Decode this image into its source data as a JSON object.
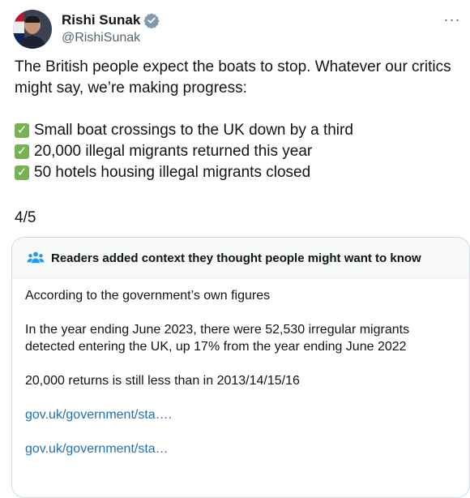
{
  "author": {
    "name": "Rishi Sunak",
    "handle": "@RishiSunak"
  },
  "tweet": {
    "intro": "The British people expect the boats to stop. Whatever our critics might say, we’re making progress:",
    "checklist": [
      "Small boat crossings to the UK down by a third",
      "20,000 illegal migrants returned this year",
      "50 hotels housing illegal migrants closed"
    ],
    "thread_counter": "4/5"
  },
  "community_note": {
    "title": "Readers added context they thought people might want to know",
    "paragraphs": [
      "According to the government’s own figures",
      "In the year ending June 2023, there were 52,530 irregular migrants detected entering the UK, up 17% from the year ending June 2022",
      "20,000 returns is still less than in 2013/14/15/16"
    ],
    "links": [
      "gov.uk/government/sta….",
      "gov.uk/government/sta…"
    ]
  },
  "colors": {
    "verified": "#829aab",
    "check": "#77b255",
    "link": "#1d70b8",
    "people_icon": "#1d9bf0"
  }
}
